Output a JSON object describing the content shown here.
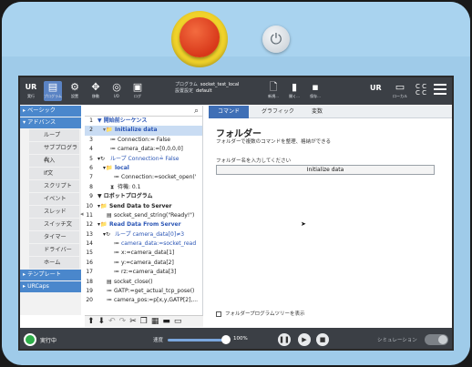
{
  "topbar": {
    "logo_label": "実行",
    "buttons": [
      {
        "icon": "program-icon",
        "label": "プログラム"
      },
      {
        "icon": "installation-icon",
        "label": "設置"
      },
      {
        "icon": "move-icon",
        "label": "移動"
      },
      {
        "icon": "io-icon",
        "label": "I/O"
      },
      {
        "icon": "log-icon",
        "label": "ログ"
      }
    ],
    "program_label": "プログラム",
    "program_value": "socket_test_local",
    "installation_label": "設置設定",
    "installation_value": "default",
    "file_buttons": [
      {
        "icon": "new-file-icon",
        "label": "新規..."
      },
      {
        "icon": "open-icon",
        "label": "開く..."
      },
      {
        "icon": "save-icon",
        "label": "保存..."
      }
    ],
    "right_labels": {
      "local": "ローカル"
    }
  },
  "sidebar": {
    "basic": "ベーシック",
    "advanced": "アドバンス",
    "items": [
      "ループ",
      "サブプログラム",
      "代入",
      "If文",
      "スクリプト",
      "イベント",
      "スレッド",
      "スイッチ文",
      "タイマー",
      "ドライバー",
      "ホーム"
    ],
    "templates": "テンプレート",
    "urcaps": "URCaps"
  },
  "tree": {
    "rows": [
      {
        "num": "1",
        "text": "▼ 開始前シーケンス"
      },
      {
        "num": "2",
        "text": "Initialize data"
      },
      {
        "num": "3",
        "text": "Connection:= False"
      },
      {
        "num": "4",
        "text": "camera_data:=[0,0,0,0]"
      },
      {
        "num": "5",
        "text": "ループ Connection≟ False"
      },
      {
        "num": "6",
        "text": "local"
      },
      {
        "num": "7",
        "text": "Connection:=socket_open('"
      },
      {
        "num": "8",
        "text": "待機: 0.1"
      },
      {
        "num": "9",
        "text": "▼ ロボットプログラム"
      },
      {
        "num": "10",
        "text": "Send Data to Server"
      },
      {
        "num": "11",
        "text": "socket_send_string(\"Ready!\")"
      },
      {
        "num": "12",
        "text": "Read Data From Server"
      },
      {
        "num": "13",
        "text": "ループ camera_data[0]≠3"
      },
      {
        "num": "14",
        "text": "camera_data:=socket_read"
      },
      {
        "num": "15",
        "text": "x:=camera_data[1]"
      },
      {
        "num": "16",
        "text": "y:=camera_data[2]"
      },
      {
        "num": "17",
        "text": "rz:=camera_data[3]"
      },
      {
        "num": "18",
        "text": "socket_close()"
      },
      {
        "num": "19",
        "text": "GATP:=get_actual_tcp_pose()"
      },
      {
        "num": "20",
        "text": "camera_pos:=p[x,y,GATP[2],..."
      }
    ],
    "toolbar_icons": [
      "move-up-icon",
      "move-down-icon",
      "undo-icon",
      "redo-icon",
      "cut-icon",
      "copy-icon",
      "paste-icon",
      "delete-icon",
      "suppress-icon"
    ]
  },
  "tabs": [
    "コマンド",
    "グラフィック",
    "変数"
  ],
  "panel": {
    "title": "フォルダー",
    "subtitle": "フォルダーで複数のコマンドを整理、格納ができる",
    "name_label": "フォルダー名を入力してください",
    "name_value": "Initialize data",
    "checkbox_label": "フォルダープログラムツリーを表示"
  },
  "bottombar": {
    "status": "実行中",
    "speed_label": "速度",
    "speed_value": "100%",
    "speed_fraction": 1.0,
    "simulation_label": "シミュレーション"
  }
}
